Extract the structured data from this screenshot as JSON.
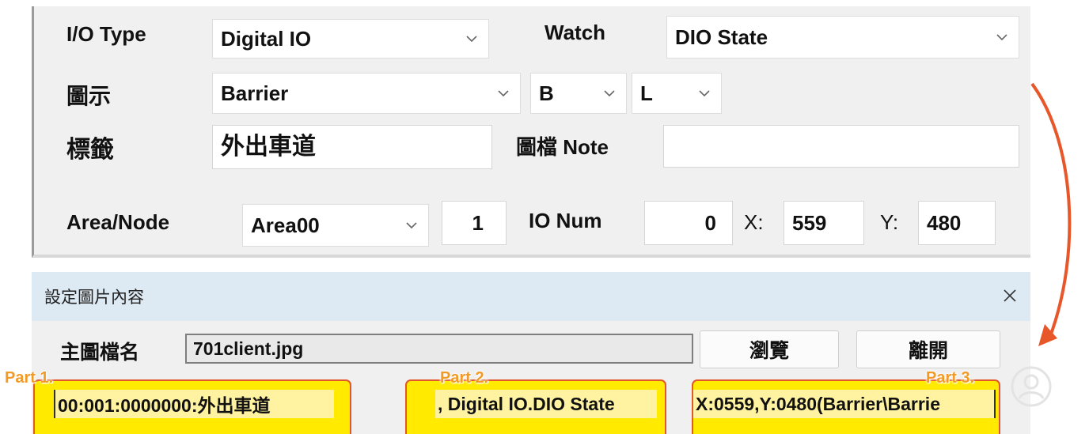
{
  "io_panel": {
    "io_type_label": "I/O Type",
    "io_type_value": "Digital IO",
    "watch_label": "Watch",
    "watch_value": "DIO State",
    "icon_label": "圖示",
    "icon_value": "Barrier",
    "icon_option_b": "B",
    "icon_option_l": "L",
    "tag_label": "標籤",
    "tag_value": "外出車道",
    "note_label": "圖檔 Note",
    "note_value": "",
    "area_node_label": "Area/Node",
    "area_value": "Area00",
    "node_value": "1",
    "io_num_label": "IO Num",
    "io_num_value": "0",
    "x_label": "X:",
    "x_value": "559",
    "y_label": "Y:",
    "y_value": "480"
  },
  "dialog": {
    "title": "設定圖片內容",
    "main_file_label": "主圖檔名",
    "main_file_value": "701client.jpg",
    "browse_button": "瀏覽",
    "exit_button": "離開"
  },
  "parts": [
    {
      "label": "Part 1.",
      "text": "00:001:0000000:外出車道"
    },
    {
      "label": "Part 2.",
      "text": ", Digital IO.DIO State"
    },
    {
      "label": "Part 3.",
      "text": "X:0559,Y:0480(Barrier\\Barrie"
    }
  ],
  "colors": {
    "highlight": "#ffea00",
    "annotation_border": "#e2572b",
    "part_label": "#f29a26",
    "arrow": "#e8572a",
    "dialog_title_bg": "#dde9f3"
  },
  "icons": {
    "dropdown": "chevron-down-icon",
    "close": "close-icon",
    "arrow": "curved-arrow-icon",
    "watermark": "user-watermark-icon"
  }
}
